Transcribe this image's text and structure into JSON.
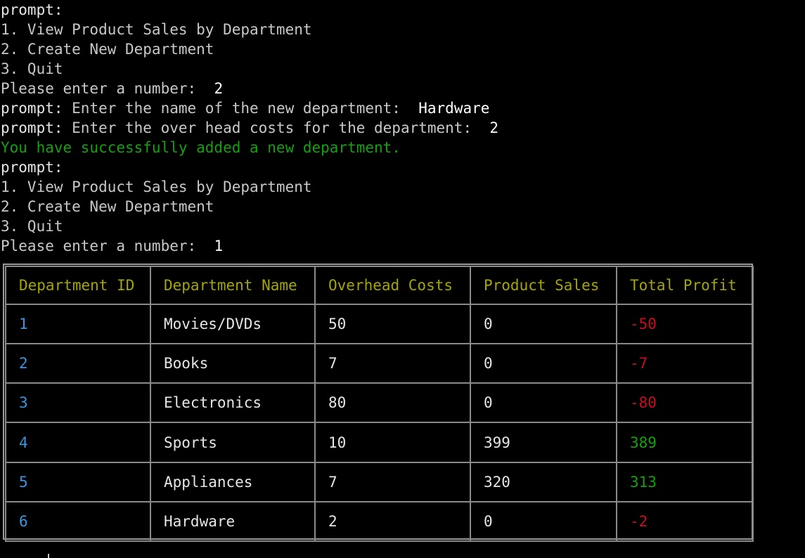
{
  "terminal": {
    "lines": [
      {
        "prefix": "prompt:",
        "text": "",
        "answer": "",
        "type": "prompt"
      },
      {
        "prefix": "",
        "text": "1. View Product Sales by Department",
        "answer": "",
        "type": "muted"
      },
      {
        "prefix": "",
        "text": "2. Create New Department",
        "answer": "",
        "type": "muted"
      },
      {
        "prefix": "",
        "text": "3. Quit",
        "answer": "",
        "type": "muted"
      },
      {
        "prefix": "",
        "text": "Please enter a number:  ",
        "answer": "2",
        "type": "muted"
      },
      {
        "prefix": "prompt:",
        "text": " Enter the name of the new department:  ",
        "answer": "Hardware",
        "type": "prompt"
      },
      {
        "prefix": "prompt:",
        "text": " Enter the over head costs for the department:  ",
        "answer": "2",
        "type": "prompt"
      },
      {
        "prefix": "",
        "text": "You have successfully added a new department.",
        "answer": "",
        "type": "success"
      },
      {
        "prefix": "prompt:",
        "text": "",
        "answer": "",
        "type": "prompt"
      },
      {
        "prefix": "",
        "text": "1. View Product Sales by Department",
        "answer": "",
        "type": "muted"
      },
      {
        "prefix": "",
        "text": "2. Create New Department",
        "answer": "",
        "type": "muted"
      },
      {
        "prefix": "",
        "text": "3. Quit",
        "answer": "",
        "type": "muted"
      },
      {
        "prefix": "",
        "text": "Please enter a number:  ",
        "answer": "1",
        "type": "muted"
      }
    ]
  },
  "table": {
    "headers": [
      "Department ID",
      "Department Name",
      "Overhead Costs",
      "Product Sales",
      "Total Profit"
    ],
    "rows": [
      {
        "id": "1",
        "name": "Movies/DVDs",
        "overhead": "50",
        "sales": "0",
        "profit": "-50",
        "profit_status": "negative"
      },
      {
        "id": "2",
        "name": "Books",
        "overhead": "7",
        "sales": "0",
        "profit": "-7",
        "profit_status": "negative"
      },
      {
        "id": "3",
        "name": "Electronics",
        "overhead": "80",
        "sales": "0",
        "profit": "-80",
        "profit_status": "negative"
      },
      {
        "id": "4",
        "name": "Sports",
        "overhead": "10",
        "sales": "399",
        "profit": "389",
        "profit_status": "positive"
      },
      {
        "id": "5",
        "name": "Appliances",
        "overhead": "7",
        "sales": "320",
        "profit": "313",
        "profit_status": "positive"
      },
      {
        "id": "6",
        "name": "Hardware",
        "overhead": "2",
        "sales": "0",
        "profit": "-2",
        "profit_status": "negative"
      }
    ]
  },
  "colors": {
    "background": "#000000",
    "text": "#c8c8c8",
    "header": "#a6a600",
    "id": "#3a96dd",
    "negative": "#c50f1f",
    "positive": "#13a10e",
    "success": "#13a10e",
    "border": "#8a8a8a"
  }
}
